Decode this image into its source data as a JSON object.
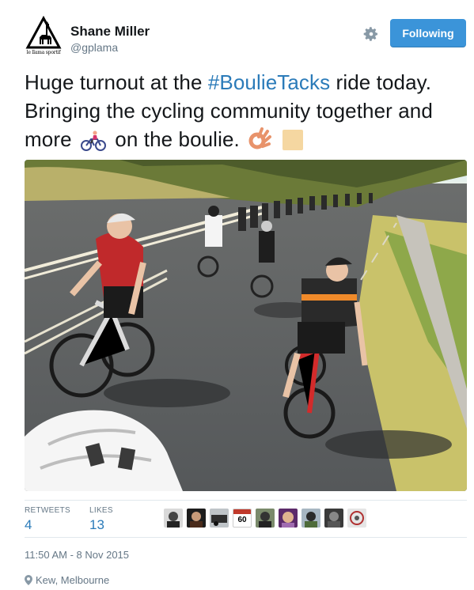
{
  "user": {
    "display_name": "Shane Miller",
    "screen_name": "@gplama",
    "avatar_caption": "le llama sportif"
  },
  "actions": {
    "follow_label": "Following",
    "settings_icon": "gear-icon"
  },
  "tweet": {
    "text_before_hashtag": "Huge turnout at the ",
    "hashtag": "#BoulieTacks",
    "text_after_hashtag": " ride today. Bringing the cycling community together and more",
    "text_after_bike": "on the boulie.",
    "emojis": [
      "bicyclist-emoji",
      "ok-hand-emoji",
      "skin-tone-modifier-emoji"
    ]
  },
  "media": {
    "type": "photo",
    "subject": "group-cycling-photo"
  },
  "stats": {
    "retweets_label": "RETWEETS",
    "retweets_value": "4",
    "likes_label": "LIKES",
    "likes_value": "13",
    "liker_badge": "60"
  },
  "meta": {
    "timestamp": "11:50 AM - 8 Nov 2015",
    "location": "Kew, Melbourne"
  },
  "colors": {
    "follow_button": "#3b94d9",
    "link": "#2b7bb9",
    "muted": "#657786",
    "divider": "#e1e8ed"
  }
}
